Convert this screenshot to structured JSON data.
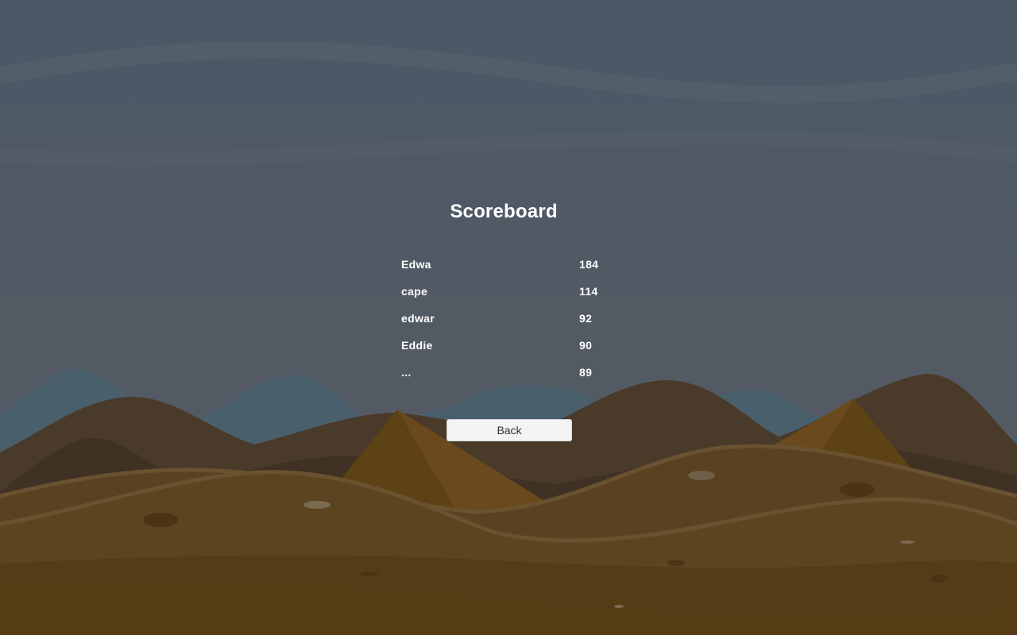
{
  "scoreboard": {
    "title": "Scoreboard",
    "entries": [
      {
        "name": "Edwa",
        "score": "184"
      },
      {
        "name": "cape",
        "score": "114"
      },
      {
        "name": "edwar",
        "score": "92"
      },
      {
        "name": "Eddie",
        "score": "90"
      },
      {
        "name": "...",
        "score": "89"
      }
    ],
    "back_label": "Back"
  },
  "colors": {
    "sky": "#4a5866",
    "far_mountains": "#4a5f6c",
    "dark_hills": "#4a3a2a",
    "dunes": "#5a4220",
    "pyramid": "#6a4a1a",
    "button": "#f3f3f3",
    "text": "#ffffff"
  }
}
